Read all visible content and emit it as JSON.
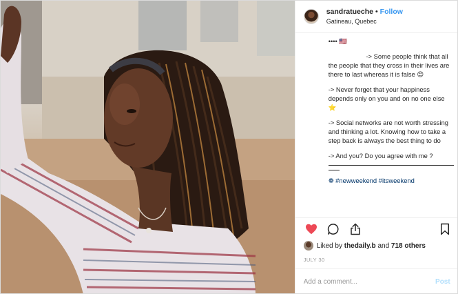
{
  "post": {
    "image_alt": "Young woman with braided hair shading her eyes in the sunlight",
    "header": {
      "username": "sandratueche",
      "separator": "•",
      "follow_label": "Follow",
      "location": "Gatineau, Quebec"
    },
    "caption": {
      "opener": "•••• 🇺🇸",
      "paragraphs": [
        "                     -> Some people think that all the people that they cross in their lives are there to last whereas it is false 😊",
        "-> Never forget that your happiness depends only on you and on no one else ⭐",
        "-> Social networks are not worth stressing and thinking a lot. Knowing how to take a step back is always the best thing to do",
        "-> And you? Do you agree with me ?"
      ],
      "hashtag_prefix": "❁",
      "hashtags": [
        "#newweekend",
        "#itsweekend"
      ]
    },
    "actions": {
      "like_icon": "heart-filled-icon",
      "comment_icon": "comment-icon",
      "share_icon": "share-icon",
      "save_icon": "bookmark-icon",
      "like_color": "#ed4956"
    },
    "likes": {
      "prefix": "Liked by",
      "user": "thedaily.b",
      "middle": "and",
      "count": "718 others"
    },
    "date": "JULY 30",
    "comment": {
      "placeholder": "Add a comment...",
      "post_label": "Post"
    }
  }
}
